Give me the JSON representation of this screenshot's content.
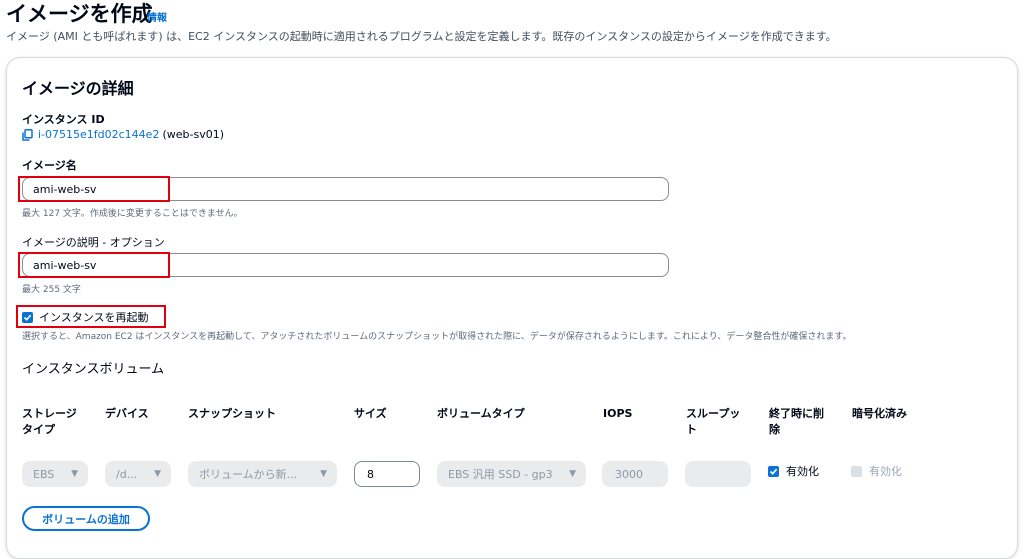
{
  "header": {
    "title": "イメージを作成",
    "info_link": "情報",
    "description": "イメージ (AMI とも呼ばれます) は、EC2 インスタンスの起動時に適用されるプログラムと設定を定義します。既存のインスタンスの設定からイメージを作成できます。"
  },
  "details": {
    "title": "イメージの詳細",
    "instance_id_label": "インスタンス ID",
    "instance_id": "i-07515e1fd02c144e2",
    "instance_name": "(web-sv01)",
    "image_name_label": "イメージ名",
    "image_name_value": "ami-web-sv",
    "image_name_hint": "最大 127 文字。作成後に変更することはできません。",
    "image_desc_label": "イメージの説明 - オプション",
    "image_desc_value": "ami-web-sv",
    "image_desc_hint": "最大 255 文字",
    "reboot_label": "インスタンスを再起動",
    "reboot_checked": true,
    "reboot_hint": "選択すると、Amazon EC2 はインスタンスを再起動して、アタッチされたボリュームのスナップショットが取得された際に、データが保存されるようにします。これにより、データ整合性が確保されます。"
  },
  "volumes": {
    "title": "インスタンスボリューム",
    "columns": {
      "storage_type": "ストレージタイプ",
      "device": "デバイス",
      "snapshot": "スナップショット",
      "size": "サイズ",
      "volume_type": "ボリュームタイプ",
      "iops": "IOPS",
      "throughput": "スループット",
      "delete_on_termination": "終了時に削除",
      "encrypted": "暗号化済み"
    },
    "row": {
      "storage_type": "EBS",
      "device": "/d...",
      "snapshot": "ボリュームから新...",
      "size": "8",
      "volume_type": "EBS 汎用 SSD - gp3",
      "iops": "3000",
      "throughput": "",
      "delete_on_termination_label": "有効化",
      "delete_on_termination_checked": true,
      "encrypted_label": "有効化",
      "encrypted_checked": false
    },
    "add_button": "ボリュームの追加"
  },
  "colors": {
    "accent": "#0972d3",
    "highlight_red": "#e0000f"
  }
}
